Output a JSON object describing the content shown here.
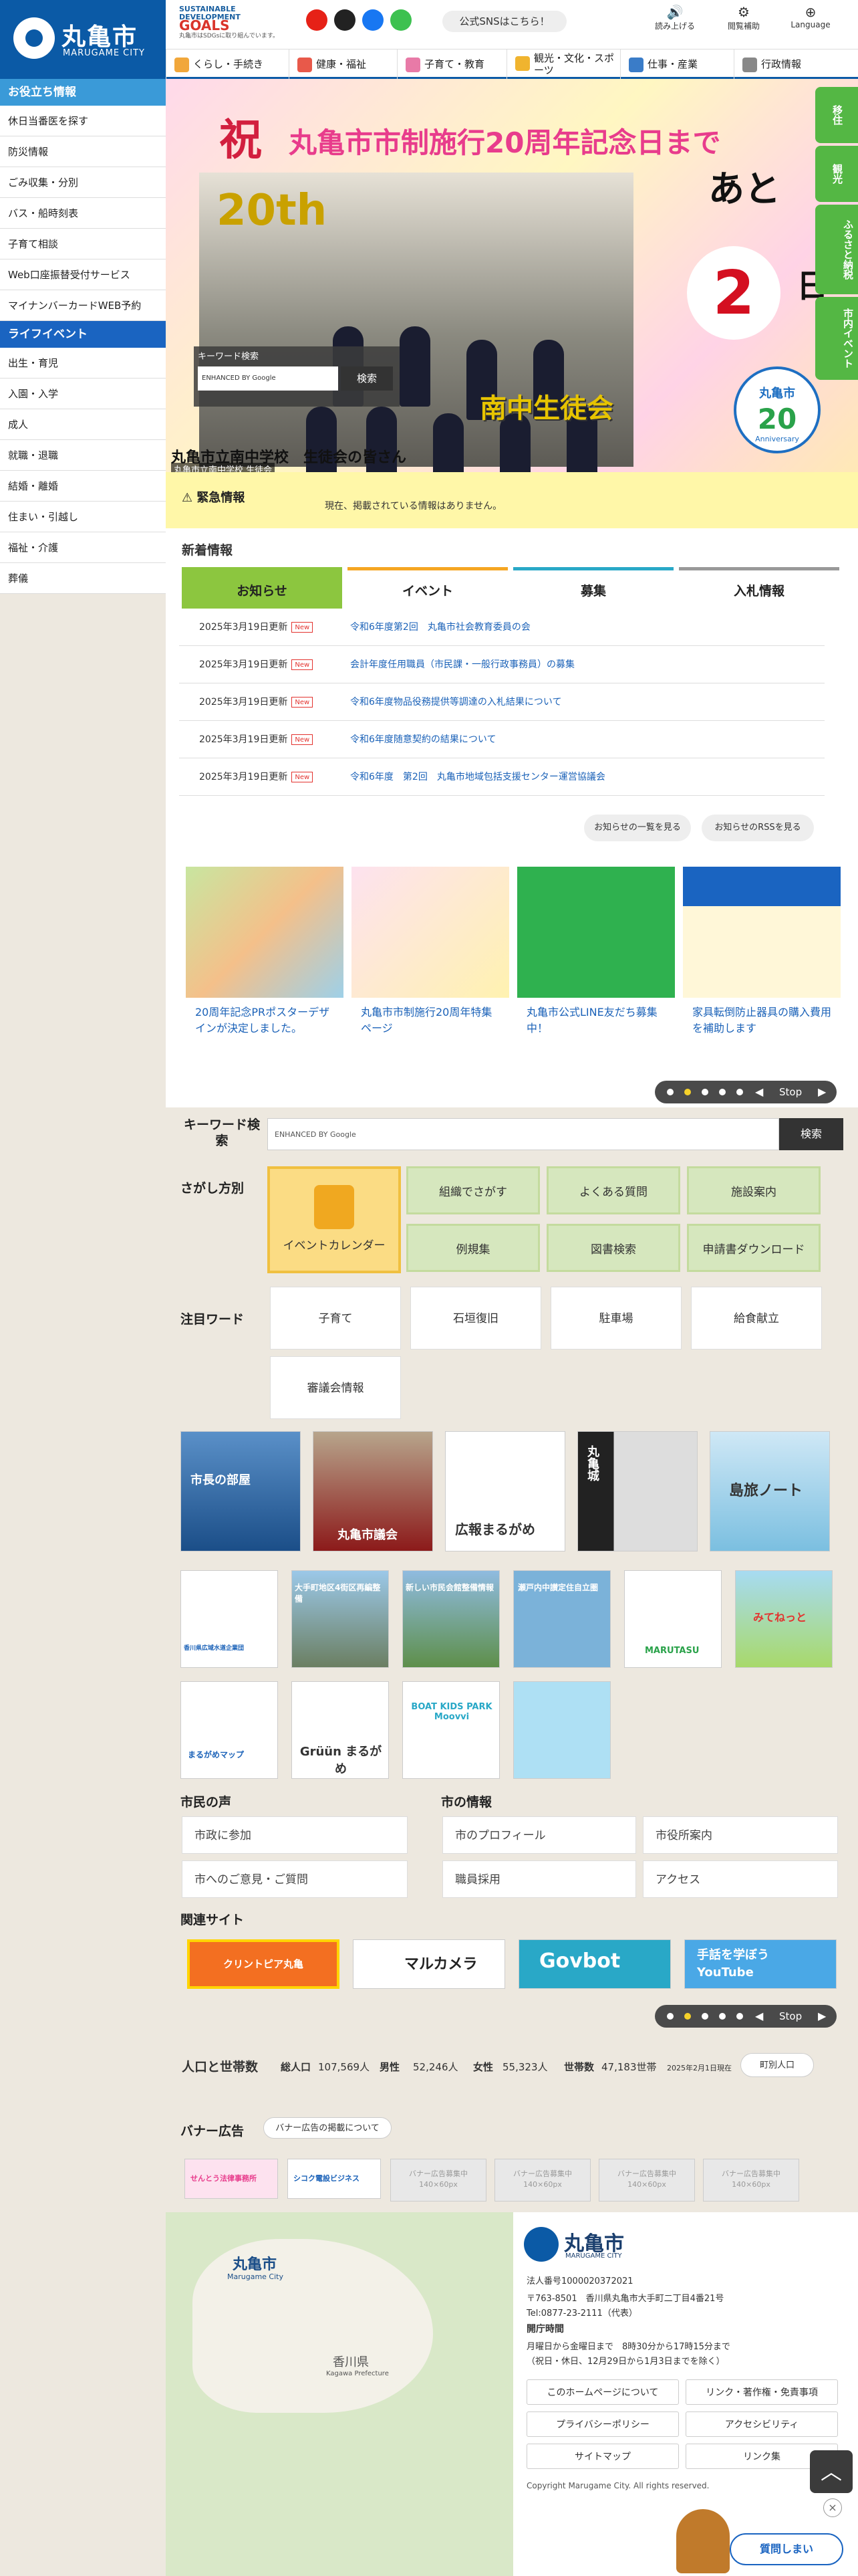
{
  "header": {
    "site_name": "丸亀市",
    "site_name_en": "MARUGAME CITY",
    "sdgs_line1": "SUSTAINABLE",
    "sdgs_line2": "DEVELOPMENT",
    "sdgs_goals": "GOALS",
    "sdgs_note": "丸亀市はSDGsに取り組んでいます。",
    "sns_button": "公式SNSはこちら！",
    "tools": [
      {
        "label": "読み上げる",
        "icon": "speaker-icon"
      },
      {
        "label": "閲覧補助",
        "icon": "gear-icon"
      },
      {
        "label": "Language",
        "icon": "globe-icon"
      }
    ]
  },
  "global_nav": [
    {
      "label": "くらし・手続き"
    },
    {
      "label": "健康・福祉"
    },
    {
      "label": "子育て・教育"
    },
    {
      "label": "観光・文化・スポーツ"
    },
    {
      "label": "仕事・産業"
    },
    {
      "label": "行政情報"
    }
  ],
  "sidebar": {
    "useful_heading": "お役立ち情報",
    "useful_items": [
      "休日当番医を探す",
      "防災情報",
      "ごみ収集・分別",
      "バス・船時刻表",
      "子育て相談",
      "Web口座振替受付サービス",
      "マイナンバーカードWEB予約"
    ],
    "life_heading": "ライフイベント",
    "life_items": [
      "出生・育児",
      "入園・入学",
      "成人",
      "就職・退職",
      "結婚・離婚",
      "住まい・引越し",
      "福祉・介護",
      "葬儀"
    ]
  },
  "hero": {
    "iwai": "祝",
    "title": "丸亀市市制施行20周年記念日まで",
    "sign": "20th",
    "school": "南中生徒会",
    "ato": "あと",
    "days": "2",
    "day_unit": "日",
    "anniv_top": "丸亀市",
    "anniv_num": "20",
    "anniv_en": "Anniversary",
    "caption": "丸亀市立南中学校　生徒会の皆さん",
    "caption_sub": "丸亀市立南中学校 生徒会",
    "keyword_label": "キーワード検索",
    "keyword_placeholder": "ENHANCED BY Google",
    "keyword_button": "検索"
  },
  "side_tabs": [
    "移住",
    "観光",
    "ふるさと納税",
    "市内イベント"
  ],
  "emergency": {
    "title": "緊急情報",
    "message": "現在、掲載されている情報はありません。"
  },
  "news": {
    "heading": "新着情報",
    "tabs": [
      {
        "label": "お知らせ",
        "color": "#8cc63f"
      },
      {
        "label": "イベント",
        "color": "#f5a623"
      },
      {
        "label": "募集",
        "color": "#29a8c7"
      },
      {
        "label": "入札情報",
        "color": "#999999"
      }
    ],
    "new_label": "New",
    "items": [
      {
        "date": "2025年3月19日更新",
        "title": "令和6年度第2回　丸亀市社会教育委員の会"
      },
      {
        "date": "2025年3月19日更新",
        "title": "会計年度任用職員（市民課・一般行政事務員）の募集"
      },
      {
        "date": "2025年3月19日更新",
        "title": "令和6年度物品役務提供等調達の入札結果について"
      },
      {
        "date": "2025年3月19日更新",
        "title": "令和6年度随意契約の結果について"
      },
      {
        "date": "2025年3月19日更新",
        "title": "令和6年度　第2回　丸亀市地域包括支援センター運営協議会"
      }
    ],
    "list_button": "お知らせの一覧を見る",
    "rss_button": "お知らせのRSSを見る"
  },
  "pickup": [
    {
      "title": "20周年記念PRポスターデザインが決定しました。"
    },
    {
      "title": "丸亀市市制施行20周年特集ページ"
    },
    {
      "title": "丸亀市公式LINE友だち募集中！"
    },
    {
      "title": "家具転倒防止器具の購入費用を補助します"
    }
  ],
  "slider_stop": "Stop",
  "search": {
    "label": "キーワード検索",
    "placeholder": "ENHANCED BY Google",
    "button": "検索"
  },
  "sagashi": {
    "heading": "さがし方別",
    "big": "イベントカレンダー",
    "items": [
      "組織でさがす",
      "よくある質問",
      "施設案内",
      "例規集",
      "図書検索",
      "申請書ダウンロード"
    ]
  },
  "chumoku": {
    "heading": "注目ワード",
    "items": [
      "子育て",
      "石垣復旧",
      "駐車場",
      "給食献立",
      "審議会情報"
    ]
  },
  "banners_big": [
    {
      "label": "市長の部屋"
    },
    {
      "label": "丸亀市議会"
    },
    {
      "label": "広報まるがめ"
    },
    {
      "label": "丸亀城"
    },
    {
      "label": "島旅ノート"
    }
  ],
  "banners_small": [
    {
      "label": "香川県広域水道企業団"
    },
    {
      "label": "大手町地区4街区再編整備"
    },
    {
      "label": "新しい市民会館整備情報"
    },
    {
      "label": "瀬戸内中讃定住自立圏"
    },
    {
      "label": "MARUTASU"
    },
    {
      "label": "みてねっと"
    },
    {
      "label": "まるがめマップ"
    },
    {
      "label": "Grüün まるがめ"
    },
    {
      "label": "BOAT KIDS PARK Moovvi"
    },
    {
      "label": ""
    }
  ],
  "shimin": {
    "heading": "市民の声",
    "items": [
      "市政に参加",
      "市へのご意見・ご質問"
    ]
  },
  "shi_info": {
    "heading": "市の情報",
    "items": [
      "市のプロフィール",
      "市役所案内",
      "職員採用",
      "アクセス"
    ]
  },
  "related": {
    "heading": "関連サイト",
    "items": [
      "クリントピア丸亀",
      "マルカメラ",
      "Govbot",
      "手話を学ぼう YouTube"
    ]
  },
  "population": {
    "label": "人口と世帯数",
    "total_label": "総人口",
    "total": "107,569人",
    "male_label": "男性",
    "male": "52,246人",
    "female_label": "女性",
    "female": "55,323人",
    "household_label": "世帯数",
    "household": "47,183世帯",
    "as_of": "2025年2月1日現在",
    "button": "町別人口"
  },
  "ads": {
    "heading": "バナー広告",
    "about": "バナー広告の掲載について",
    "items": [
      "せんとう法律事務所",
      "シコク電設ビジネス"
    ],
    "empty": "バナー広告募集中",
    "size": "140×60px"
  },
  "footer": {
    "map_city": "丸亀市",
    "map_city_en": "Marugame City",
    "map_pref": "香川県",
    "map_pref_en": "Kagawa Prefecture",
    "name": "丸亀市",
    "name_en": "MARUGAME CITY",
    "corp_no": "法人番号1000020372021",
    "address": "〒763-8501　香川県丸亀市大手町二丁目4番21号",
    "tel": "Tel:0877-23-2111（代表）",
    "hours_label": "開庁時間",
    "hours": "月曜日から金曜日まで　8時30分から17時15分まで",
    "hours_note": "（祝日・休日、12月29日から1月3日までを除く）",
    "links": [
      "このホームページについて",
      "リンク・著作権・免責事項",
      "プライバシーポリシー",
      "アクセシビリティ",
      "サイトマップ",
      "リンク集"
    ],
    "copyright": "Copyright Marugame City. All rights reserved."
  },
  "chat_button": "質問しまい"
}
